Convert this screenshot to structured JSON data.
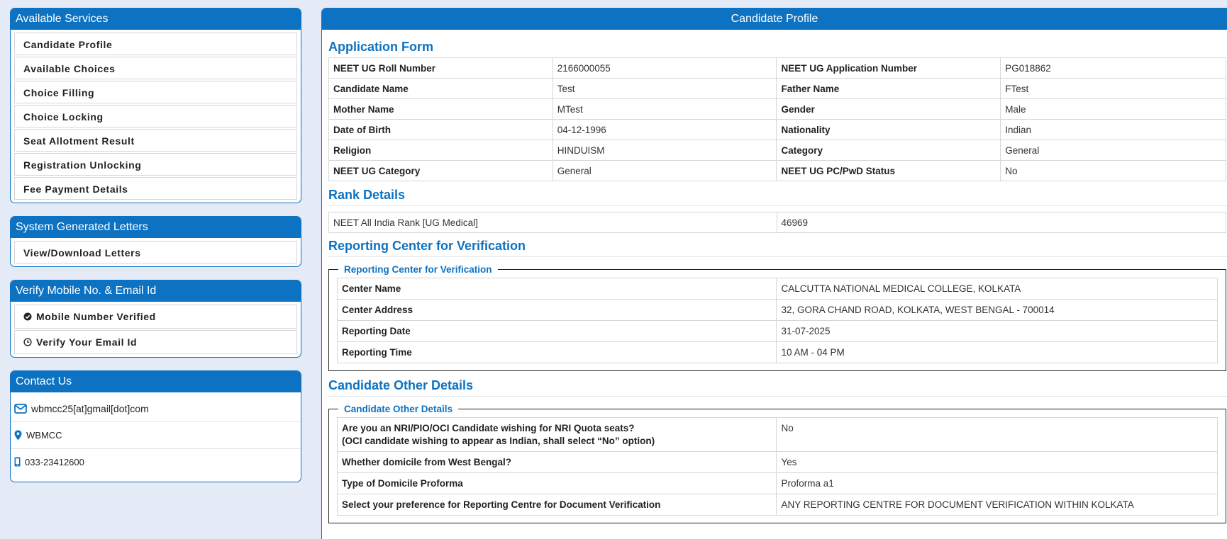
{
  "sidebar": {
    "services": {
      "title": "Available Services",
      "items": [
        "Candidate Profile",
        "Available Choices",
        "Choice Filling",
        "Choice Locking",
        "Seat Allotment Result",
        "Registration Unlocking",
        "Fee Payment Details"
      ]
    },
    "letters": {
      "title": "System Generated Letters",
      "items": [
        "View/Download Letters"
      ]
    },
    "verify": {
      "title": "Verify Mobile No. & Email Id",
      "mobile": "Mobile Number Verified",
      "email": "Verify Your Email Id"
    },
    "contact": {
      "title": "Contact Us",
      "email": "wbmcc25[at]gmail[dot]com",
      "org": "WBMCC",
      "phone": "033-23412600"
    }
  },
  "main": {
    "title": "Candidate Profile",
    "application_form": {
      "title": "Application Form",
      "rows": [
        [
          "NEET UG Roll Number",
          "2166000055",
          "NEET UG Application Number",
          "PG018862"
        ],
        [
          "Candidate Name",
          "Test",
          "Father Name",
          "FTest"
        ],
        [
          "Mother Name",
          "MTest",
          "Gender",
          "Male"
        ],
        [
          "Date of Birth",
          "04-12-1996",
          "Nationality",
          "Indian"
        ],
        [
          "Religion",
          "HINDUISM",
          "Category",
          "General"
        ],
        [
          "NEET UG Category",
          "General",
          "NEET UG PC/PwD Status",
          "No"
        ]
      ]
    },
    "rank_details": {
      "title": "Rank Details",
      "label": "NEET All India Rank [UG Medical]",
      "value": "46969"
    },
    "reporting_center": {
      "title": "Reporting Center for Verification",
      "legend": "Reporting Center for Verification",
      "rows": [
        [
          "Center Name",
          "CALCUTTA NATIONAL MEDICAL COLLEGE, KOLKATA"
        ],
        [
          "Center Address",
          "32, GORA CHAND ROAD, KOLKATA, WEST BENGAL - 700014"
        ],
        [
          "Reporting Date",
          "31-07-2025"
        ],
        [
          "Reporting Time",
          "10 AM - 04 PM"
        ]
      ]
    },
    "other_details": {
      "title": "Candidate Other Details",
      "legend": "Candidate Other Details",
      "nri_question_line1": "Are you an NRI/PIO/OCI Candidate wishing for NRI Quota seats?",
      "nri_question_line2": "(OCI candidate wishing to appear as Indian, shall select “No” option)",
      "nri_answer": "No",
      "rows": [
        [
          "Whether domicile from West Bengal?",
          "Yes"
        ],
        [
          "Type of Domicile Proforma",
          "Proforma a1"
        ],
        [
          "Select your preference for Reporting Centre for Document Verification",
          "ANY REPORTING CENTRE FOR DOCUMENT VERIFICATION WITHIN KOLKATA"
        ]
      ]
    }
  },
  "colors": {
    "brand": "#0d72c2",
    "page_bg": "#e4ebf7"
  },
  "icons": {
    "mobile_verified": "check-circle-icon",
    "email_verify": "clock-icon",
    "contact_email": "envelope-icon",
    "contact_org": "map-marker-icon",
    "contact_phone": "mobile-phone-icon"
  }
}
